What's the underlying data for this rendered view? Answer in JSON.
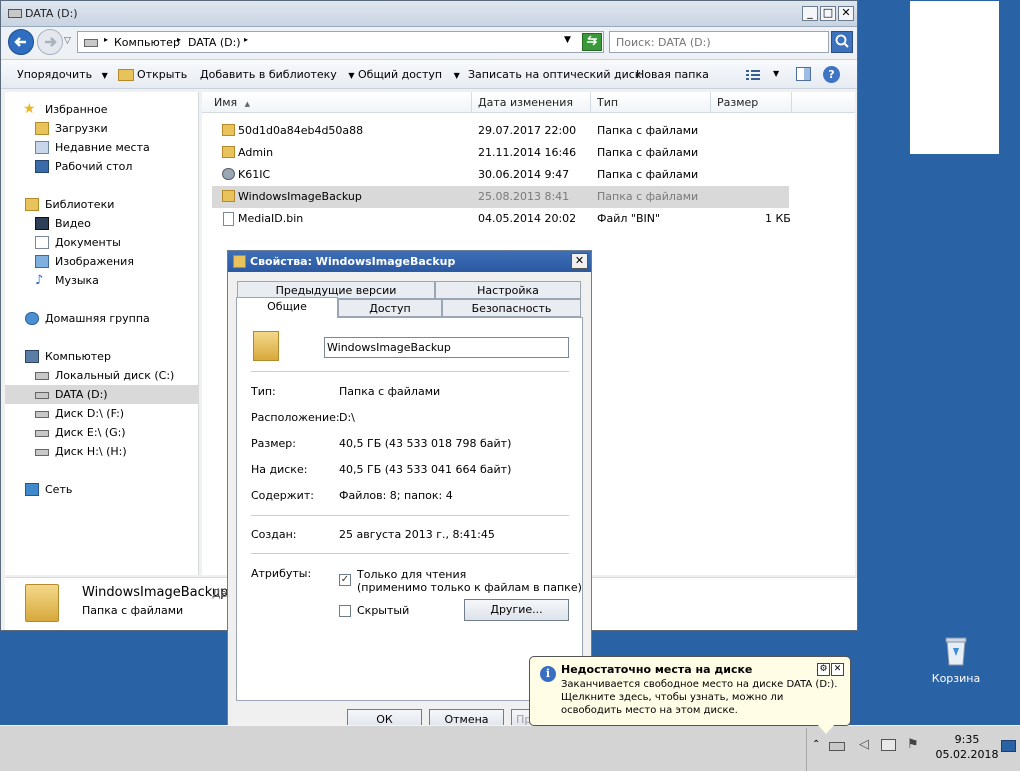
{
  "explorer": {
    "title": "DATA (D:)",
    "breadcrumb": [
      "Компьютер",
      "DATA (D:)"
    ],
    "search_placeholder": "Поиск: DATA (D:)",
    "toolbar": {
      "organize": "Упорядочить",
      "open": "Открыть",
      "add_library": "Добавить в библиотеку",
      "share": "Общий доступ",
      "burn": "Записать на оптический диск",
      "new_folder": "Новая папка"
    },
    "nav": {
      "favorites": "Избранное",
      "downloads": "Загрузки",
      "recent": "Недавние места",
      "desktop": "Рабочий стол",
      "libraries": "Библиотеки",
      "video": "Видео",
      "documents": "Документы",
      "pictures": "Изображения",
      "music": "Музыка",
      "homegroup": "Домашняя группа",
      "computer": "Компьютер",
      "local_c": "Локальный диск (C:)",
      "data_d": "DATA (D:)",
      "disk_f": "Диск D:\\ (F:)",
      "disk_g": "Диск E:\\ (G:)",
      "disk_h": "Диск H:\\ (H:)",
      "network": "Сеть"
    },
    "columns": {
      "name": "Имя",
      "date": "Дата изменения",
      "type": "Тип",
      "size": "Размер"
    },
    "files": [
      {
        "name": "50d1d0a84eb4d50a88",
        "date": "29.07.2017 22:00",
        "type": "Папка с файлами",
        "size": ""
      },
      {
        "name": "Admin",
        "date": "21.11.2014 16:46",
        "type": "Папка с файлами",
        "size": ""
      },
      {
        "name": "K61IC",
        "date": "30.06.2014 9:47",
        "type": "Папка с файлами",
        "size": ""
      },
      {
        "name": "WindowsImageBackup",
        "date": "25.08.2013 8:41",
        "type": "Папка с файлами",
        "size": ""
      },
      {
        "name": "MediaID.bin",
        "date": "04.05.2014 20:02",
        "type": "Файл \"BIN\"",
        "size": "1 КБ"
      }
    ],
    "details": {
      "name": "WindowsImageBackup",
      "extra": "Дат",
      "type": "Папка с файлами"
    }
  },
  "props": {
    "title": "Свойства: WindowsImageBackup",
    "tabs": {
      "prev": "Предыдущие версии",
      "settings": "Настройка",
      "general": "Общие",
      "access": "Доступ",
      "security": "Безопасность"
    },
    "name_value": "WindowsImageBackup",
    "type_label": "Тип:",
    "type_value": "Папка с файлами",
    "location_label": "Расположение:",
    "location_value": "D:\\",
    "size_label": "Размер:",
    "size_value": "40,5 ГБ (43 533 018 798 байт)",
    "disk_label": "На диске:",
    "disk_value": "40,5 ГБ (43 533 041 664 байт)",
    "contains_label": "Содержит:",
    "contains_value": "Файлов: 8; папок: 4",
    "created_label": "Создан:",
    "created_value": "25 августа 2013 г., 8:41:45",
    "attrs_label": "Атрибуты:",
    "readonly_label": "Только для чтения",
    "readonly_note": "(применимо только к файлам в папке)",
    "hidden_label": "Скрытый",
    "other_button": "Другие...",
    "ok": "ОК",
    "cancel": "Отмена",
    "apply": "Применить"
  },
  "balloon": {
    "title": "Недостаточно места на диске",
    "text": "Заканчивается свободное место на диске DATA (D:). Щелкните здесь, чтобы узнать, можно ли освободить место на этом диске."
  },
  "desktop": {
    "recycle_bin": "Корзина"
  },
  "tray": {
    "time": "9:35",
    "date": "05.02.2018"
  }
}
